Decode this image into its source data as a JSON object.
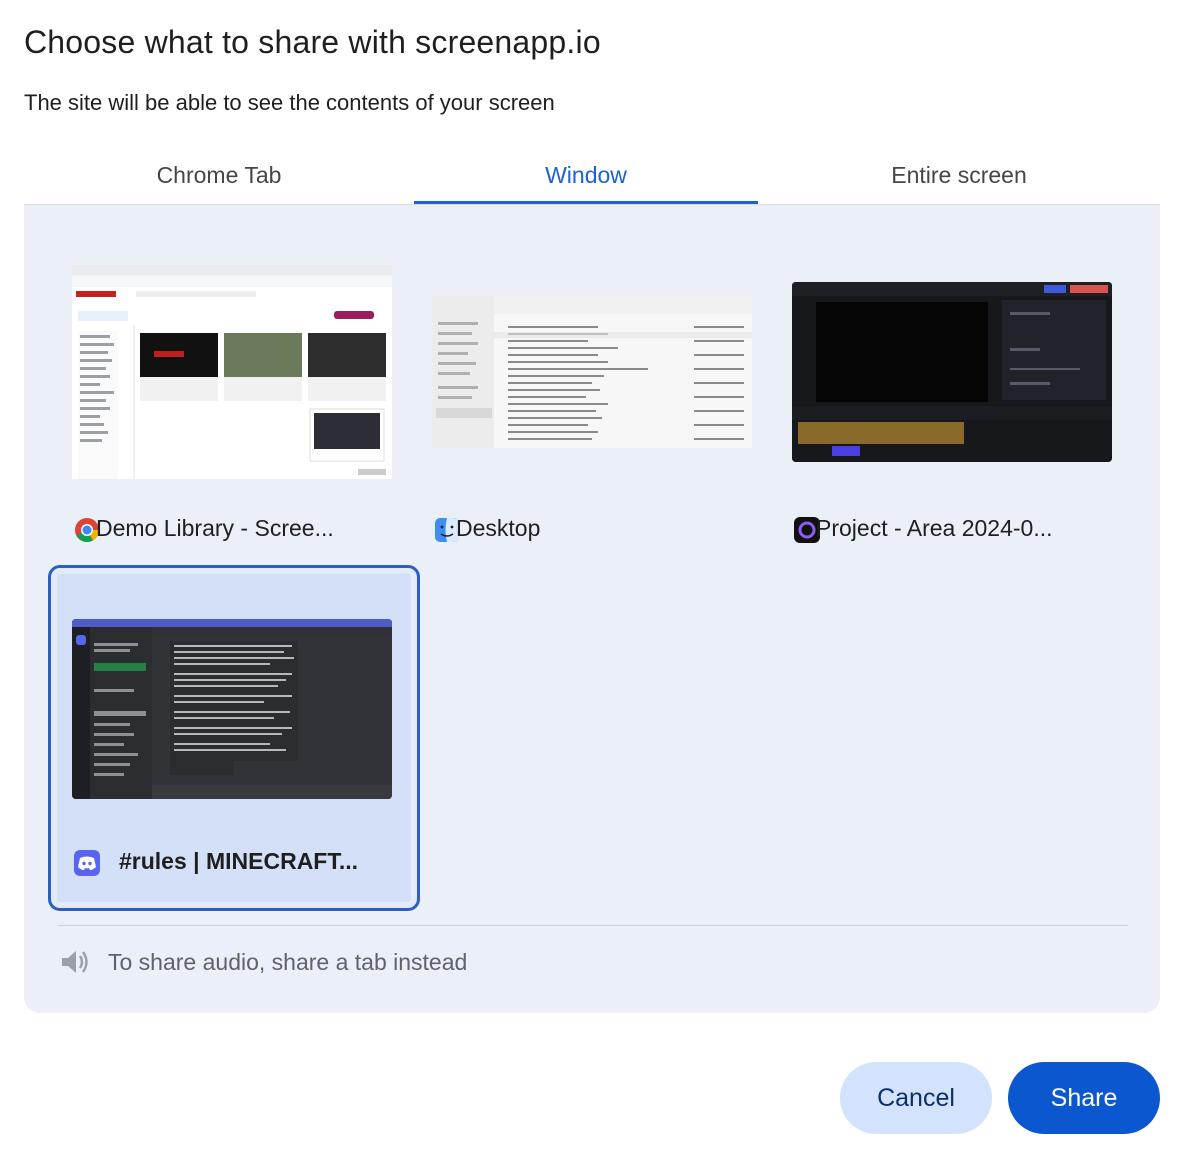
{
  "dialog": {
    "title": "Choose what to share with screenapp.io",
    "subtitle": "The site will be able to see the contents of your screen"
  },
  "tabs": [
    {
      "label": "Chrome Tab",
      "active": false
    },
    {
      "label": "Window",
      "active": true
    },
    {
      "label": "Entire screen",
      "active": false
    }
  ],
  "windows": [
    {
      "label": "Demo Library - Scree...",
      "icon": "chrome-icon",
      "selected": false
    },
    {
      "label": "Desktop",
      "icon": "finder-icon",
      "selected": false
    },
    {
      "label": "Project - Area 2024-0...",
      "icon": "screenapp-project-icon",
      "selected": false
    },
    {
      "label": "#rules | MINECRAFT...",
      "icon": "discord-icon",
      "selected": true
    }
  ],
  "audio_note": "To share audio, share a tab instead",
  "buttons": {
    "cancel": "Cancel",
    "share": "Share"
  },
  "colors": {
    "accent": "#1a62d6",
    "panel": "#ebeff7",
    "share_button": "#0b57d0",
    "cancel_button": "#d3e3fd"
  }
}
